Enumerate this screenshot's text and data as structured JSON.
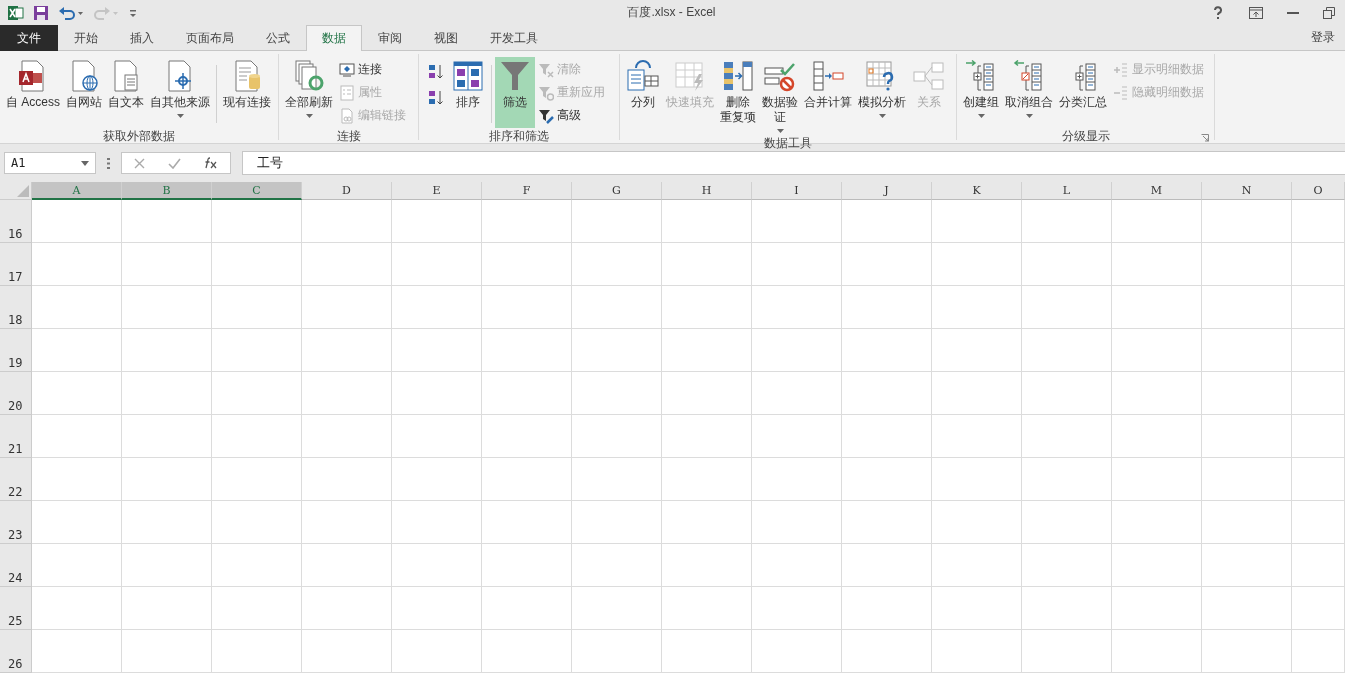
{
  "window": {
    "title": "百度.xlsx - Excel"
  },
  "quick_access": [
    {
      "kind": "save",
      "disabled": false
    },
    {
      "kind": "undo",
      "disabled": false
    },
    {
      "kind": "redo",
      "disabled": true
    },
    {
      "kind": "customize",
      "disabled": false
    }
  ],
  "tabs": [
    {
      "label": "文件",
      "kind": "file",
      "selected": false
    },
    {
      "label": "开始",
      "kind": "tab",
      "selected": false
    },
    {
      "label": "插入",
      "kind": "tab",
      "selected": false
    },
    {
      "label": "页面布局",
      "kind": "tab",
      "selected": false
    },
    {
      "label": "公式",
      "kind": "tab",
      "selected": false
    },
    {
      "label": "数据",
      "kind": "tab",
      "selected": true
    },
    {
      "label": "审阅",
      "kind": "tab",
      "selected": false
    },
    {
      "label": "视图",
      "kind": "tab",
      "selected": false
    },
    {
      "label": "开发工具",
      "kind": "tab",
      "selected": false
    }
  ],
  "sign_in": "登录",
  "ribbon_groups": [
    {
      "label": "获取外部数据",
      "launcher": false,
      "items": [
        {
          "kind": "large",
          "lines": [
            "自 Access"
          ],
          "disabled": false,
          "dropdown": false,
          "selected": false
        },
        {
          "kind": "large",
          "lines": [
            "自网站"
          ],
          "disabled": false,
          "dropdown": false,
          "selected": false
        },
        {
          "kind": "large",
          "lines": [
            "自文本"
          ],
          "disabled": false,
          "dropdown": false,
          "selected": false
        },
        {
          "kind": "large",
          "lines": [
            "自其他来源"
          ],
          "disabled": false,
          "dropdown": true,
          "selected": false
        },
        {
          "kind": "separator"
        },
        {
          "kind": "large",
          "lines": [
            "现有连接"
          ],
          "disabled": false,
          "dropdown": false,
          "selected": false
        }
      ]
    },
    {
      "label": "连接",
      "launcher": false,
      "items": [
        {
          "kind": "large",
          "lines": [
            "全部刷新"
          ],
          "disabled": false,
          "dropdown": true,
          "selected": false
        },
        {
          "kind": "stack",
          "items": [
            {
              "label": "连接",
              "disabled": false
            },
            {
              "label": "属性",
              "disabled": true
            },
            {
              "label": "编辑链接",
              "disabled": true
            }
          ]
        }
      ]
    },
    {
      "label": "排序和筛选",
      "launcher": false,
      "items": [
        {
          "kind": "sort-pair"
        },
        {
          "kind": "large",
          "lines": [
            "排序"
          ],
          "disabled": false,
          "dropdown": false,
          "selected": false
        },
        {
          "kind": "separator"
        },
        {
          "kind": "large",
          "lines": [
            "筛选"
          ],
          "disabled": false,
          "dropdown": false,
          "selected": true
        },
        {
          "kind": "stack",
          "items": [
            {
              "label": "清除",
              "disabled": true
            },
            {
              "label": "重新应用",
              "disabled": true
            },
            {
              "label": "高级",
              "disabled": false
            }
          ]
        }
      ]
    },
    {
      "label": "数据工具",
      "launcher": false,
      "items": [
        {
          "kind": "large",
          "lines": [
            "分列"
          ],
          "disabled": false,
          "dropdown": false,
          "selected": false
        },
        {
          "kind": "large",
          "lines": [
            "快速填充"
          ],
          "disabled": true,
          "dropdown": false,
          "selected": false
        },
        {
          "kind": "large",
          "lines": [
            "删除",
            "重复项"
          ],
          "disabled": false,
          "dropdown": false,
          "selected": false
        },
        {
          "kind": "large",
          "lines": [
            "数据验",
            "证"
          ],
          "disabled": false,
          "dropdown": true,
          "selected": false
        },
        {
          "kind": "large",
          "lines": [
            "合并计算"
          ],
          "disabled": false,
          "dropdown": false,
          "selected": false
        },
        {
          "kind": "large",
          "lines": [
            "模拟分析"
          ],
          "disabled": false,
          "dropdown": true,
          "selected": false
        },
        {
          "kind": "large",
          "lines": [
            "关系"
          ],
          "disabled": true,
          "dropdown": false,
          "selected": false
        }
      ]
    },
    {
      "label": "分级显示",
      "launcher": true,
      "items": [
        {
          "kind": "large",
          "lines": [
            "创建组"
          ],
          "disabled": false,
          "dropdown": true,
          "selected": false
        },
        {
          "kind": "large",
          "lines": [
            "取消组合"
          ],
          "disabled": false,
          "dropdown": true,
          "selected": false
        },
        {
          "kind": "large",
          "lines": [
            "分类汇总"
          ],
          "disabled": false,
          "dropdown": false,
          "selected": false
        },
        {
          "kind": "stack",
          "items": [
            {
              "label": "显示明细数据",
              "disabled": true
            },
            {
              "label": "隐藏明细数据",
              "disabled": true
            }
          ]
        }
      ]
    }
  ],
  "formula_bar": {
    "name_box": "A1",
    "value": "工号"
  },
  "sheet": {
    "columns": [
      {
        "label": "A",
        "selected": true
      },
      {
        "label": "B",
        "selected": true
      },
      {
        "label": "C",
        "selected": true
      },
      {
        "label": "D",
        "selected": false
      },
      {
        "label": "E",
        "selected": false
      },
      {
        "label": "F",
        "selected": false
      },
      {
        "label": "G",
        "selected": false
      },
      {
        "label": "H",
        "selected": false
      },
      {
        "label": "I",
        "selected": false
      },
      {
        "label": "J",
        "selected": false
      },
      {
        "label": "K",
        "selected": false
      },
      {
        "label": "L",
        "selected": false
      },
      {
        "label": "M",
        "selected": false
      },
      {
        "label": "N",
        "selected": false
      },
      {
        "label": "O",
        "selected": false
      }
    ],
    "rows": [
      "16",
      "17",
      "18",
      "19",
      "20",
      "21",
      "22",
      "23",
      "24",
      "25",
      "26"
    ]
  }
}
